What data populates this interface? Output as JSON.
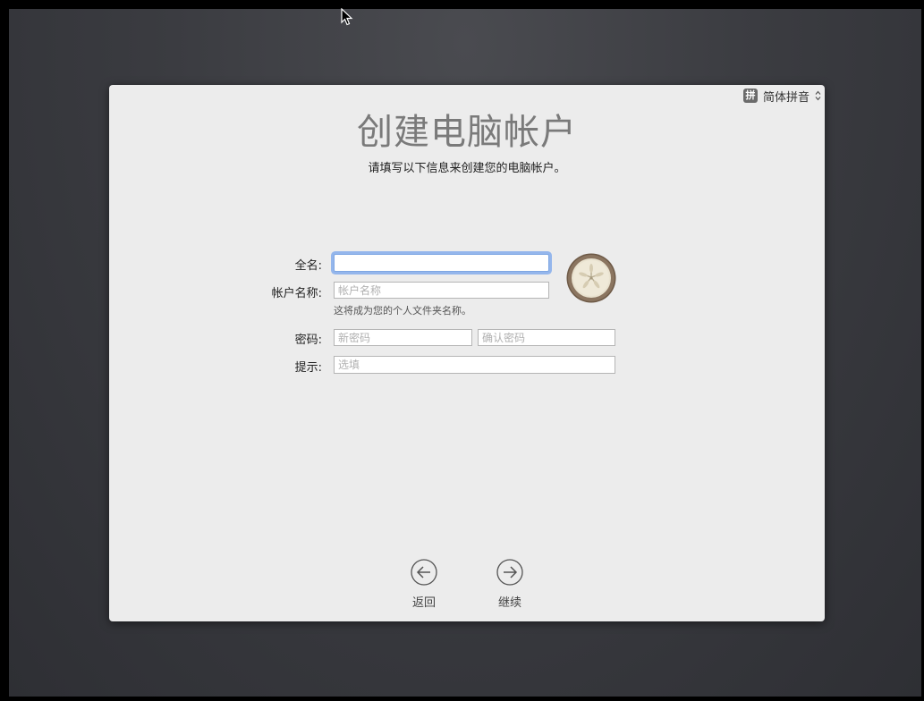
{
  "input_method": {
    "badge": "拼",
    "label": "简体拼音"
  },
  "page": {
    "title": "创建电脑帐户",
    "subtitle": "请填写以下信息来创建您的电脑帐户。"
  },
  "form": {
    "full_name_label": "全名:",
    "full_name_value": "",
    "account_name_label": "帐户名称:",
    "account_name_placeholder": "帐户名称",
    "account_name_hint": "这将成为您的个人文件夹名称。",
    "password_label": "密码:",
    "new_password_placeholder": "新密码",
    "confirm_password_placeholder": "确认密码",
    "hint_label": "提示:",
    "hint_placeholder": "选填"
  },
  "nav": {
    "back_label": "返回",
    "continue_label": "继续"
  }
}
